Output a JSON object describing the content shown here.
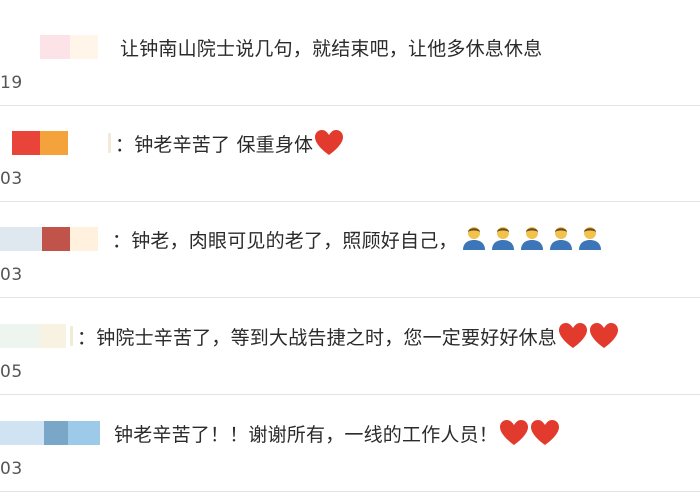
{
  "comments": [
    {
      "text": "让钟南山院士说几句，就结束吧，让他多休息休息",
      "timestamp": "19",
      "emoji": [],
      "masked_name_colors": [
        "#fbe3e8",
        "#fff5e8"
      ]
    },
    {
      "text": "：钟老辛苦了 保重身体",
      "timestamp": "03",
      "emoji": [
        "red-heart-emoji"
      ],
      "masked_name_colors": [
        "#e9443a",
        "#f3a23c"
      ]
    },
    {
      "text": "：钟老，肉眼可见的老了，照顾好自己，",
      "timestamp": "03",
      "emoji": [
        "person-emoji",
        "person-emoji",
        "person-emoji",
        "person-emoji",
        "person-emoji"
      ],
      "masked_name_colors": [
        "#dfe7ef",
        "#c0534a",
        "#fff1de"
      ]
    },
    {
      "text": "：钟院士辛苦了，等到大战告捷之时，您一定要好好休息",
      "timestamp": "05",
      "emoji": [
        "red-heart-emoji",
        "red-heart-emoji"
      ],
      "masked_name_colors": [
        "#eef5ee",
        "#f7f2e2"
      ]
    },
    {
      "text": "钟老辛苦了！！谢谢所有，一线的工作人员！",
      "timestamp": "03",
      "emoji": [
        "red-heart-emoji",
        "red-heart-emoji"
      ],
      "masked_name_colors": [
        "#cfe3f2",
        "#7aa7c8",
        "#9ecaea"
      ]
    }
  ],
  "colors": {
    "heart": "#e23a2c",
    "divider": "#e3e3e3",
    "text": "#2b2b2b",
    "timestamp": "#555555"
  }
}
